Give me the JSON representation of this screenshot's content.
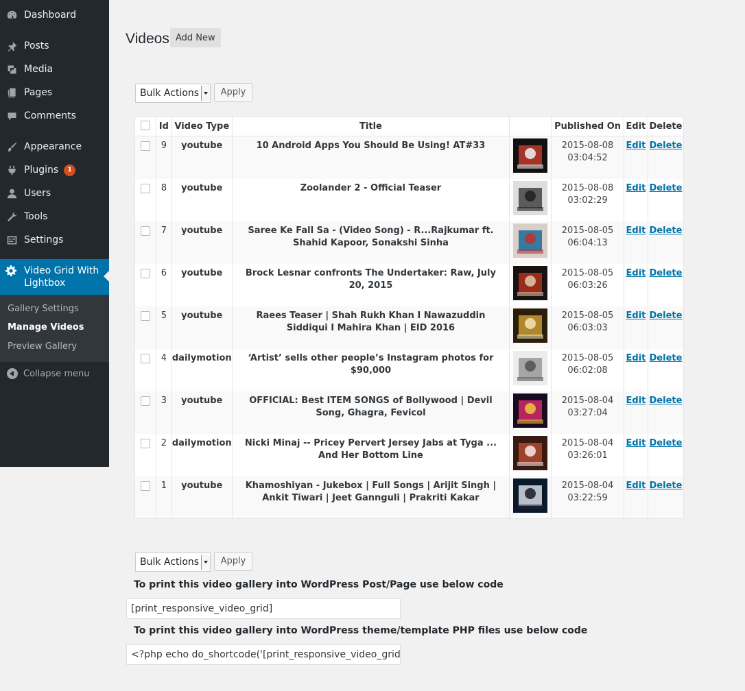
{
  "sidebar": {
    "items": [
      {
        "label": "Dashboard",
        "icon": "dashboard-icon"
      },
      {
        "label": "Posts",
        "icon": "pin-icon"
      },
      {
        "label": "Media",
        "icon": "media-icon"
      },
      {
        "label": "Pages",
        "icon": "pages-icon"
      },
      {
        "label": "Comments",
        "icon": "comment-icon"
      },
      {
        "label": "Appearance",
        "icon": "brush-icon"
      },
      {
        "label": "Plugins",
        "icon": "plugin-icon",
        "badge": "1"
      },
      {
        "label": "Users",
        "icon": "user-icon"
      },
      {
        "label": "Tools",
        "icon": "wrench-icon"
      },
      {
        "label": "Settings",
        "icon": "settings-icon"
      }
    ],
    "active": {
      "label": "Video Grid With Lightbox",
      "icon": "gear-icon"
    },
    "submenu": [
      "Gallery Settings",
      "Manage Videos",
      "Preview Gallery"
    ],
    "collapse": "Collapse menu"
  },
  "header": {
    "title": "Videos",
    "add_new": "Add New"
  },
  "bulk": {
    "label": "Bulk Actions",
    "apply": "Apply"
  },
  "table": {
    "columns": [
      "Id",
      "Video Type",
      "Title",
      "",
      "Published On",
      "Edit",
      "Delete"
    ],
    "edit_label": "Edit",
    "delete_label": "Delete",
    "rows": [
      {
        "id": "9",
        "type": "youtube",
        "title": "10 Android Apps You Should Be Using! AT#33",
        "date": "2015-08-08",
        "time": "03:04:52"
      },
      {
        "id": "8",
        "type": "youtube",
        "title": "Zoolander 2 - Official Teaser",
        "date": "2015-08-08",
        "time": "03:02:29"
      },
      {
        "id": "7",
        "type": "youtube",
        "title": "Saree Ke Fall Sa - (Video Song) - R...Rajkumar ft. Shahid Kapoor, Sonakshi Sinha",
        "date": "2015-08-05",
        "time": "06:04:13"
      },
      {
        "id": "6",
        "type": "youtube",
        "title": "Brock Lesnar confronts The Undertaker: Raw, July 20, 2015",
        "date": "2015-08-05",
        "time": "06:03:26"
      },
      {
        "id": "5",
        "type": "youtube",
        "title": "Raees Teaser | Shah Rukh Khan I Nawazuddin Siddiqui I Mahira Khan | EID 2016",
        "date": "2015-08-05",
        "time": "06:03:03"
      },
      {
        "id": "4",
        "type": "dailymotion",
        "title": "‘Artist’ sells other people’s Instagram photos for $90,000",
        "date": "2015-08-05",
        "time": "06:02:08"
      },
      {
        "id": "3",
        "type": "youtube",
        "title": "OFFICIAL: Best ITEM SONGS of Bollywood | Devil Song, Ghagra, Fevicol",
        "date": "2015-08-04",
        "time": "03:27:04"
      },
      {
        "id": "2",
        "type": "dailymotion",
        "title": "Nicki Minaj -- Pricey Pervert Jersey Jabs at Tyga ... And Her Bottom Line",
        "date": "2015-08-04",
        "time": "03:26:01"
      },
      {
        "id": "1",
        "type": "youtube",
        "title": "Khamoshiyan - Jukebox | Full Songs | Arijit Singh | Ankit Tiwari | Jeet Gannguli | Prakriti Kakar",
        "date": "2015-08-04",
        "time": "03:22:59"
      }
    ]
  },
  "shortcode": {
    "post_label": "To print this video gallery into WordPress Post/Page use below code",
    "post_value": "[print_responsive_video_grid]",
    "php_label": "To print this video gallery into WordPress theme/template PHP files use below code",
    "php_value": "<?php echo do_shortcode('[print_responsive_video_grid]'); ?>"
  }
}
